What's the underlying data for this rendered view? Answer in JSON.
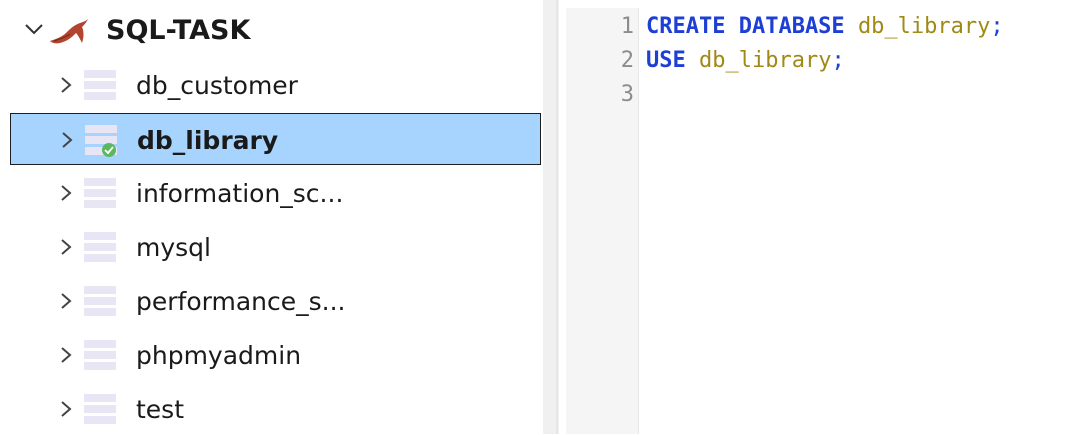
{
  "tree": {
    "root": {
      "label": "SQL-TASK",
      "icon": "mysql-dolphin-icon",
      "expanded": true
    },
    "items": [
      {
        "label": "db_customer",
        "selected": false,
        "connected": false
      },
      {
        "label": "db_library",
        "selected": true,
        "connected": true
      },
      {
        "label": "information_sc...",
        "selected": false,
        "connected": false
      },
      {
        "label": "mysql",
        "selected": false,
        "connected": false
      },
      {
        "label": "performance_s...",
        "selected": false,
        "connected": false
      },
      {
        "label": "phpmyadmin",
        "selected": false,
        "connected": false
      },
      {
        "label": "test",
        "selected": false,
        "connected": false
      }
    ]
  },
  "editor": {
    "line_numbers": [
      "1",
      "2",
      "3"
    ],
    "lines": [
      [
        {
          "t": "CREATE DATABASE",
          "k": "kw"
        },
        {
          "t": " ",
          "k": "sp"
        },
        {
          "t": "db_library",
          "k": "id"
        },
        {
          "t": ";",
          "k": "pun"
        }
      ],
      [
        {
          "t": "USE",
          "k": "kw"
        },
        {
          "t": " ",
          "k": "sp"
        },
        {
          "t": "db_library",
          "k": "id"
        },
        {
          "t": ";",
          "k": "pun"
        }
      ],
      []
    ]
  },
  "colors": {
    "selection": "#a6d4ff",
    "keyword": "#1e3fd6",
    "identifier": "#a08a16",
    "db_icon": "#e8e6f5",
    "connected_badge": "#5cb85c",
    "dolphin": "#b3452f"
  }
}
